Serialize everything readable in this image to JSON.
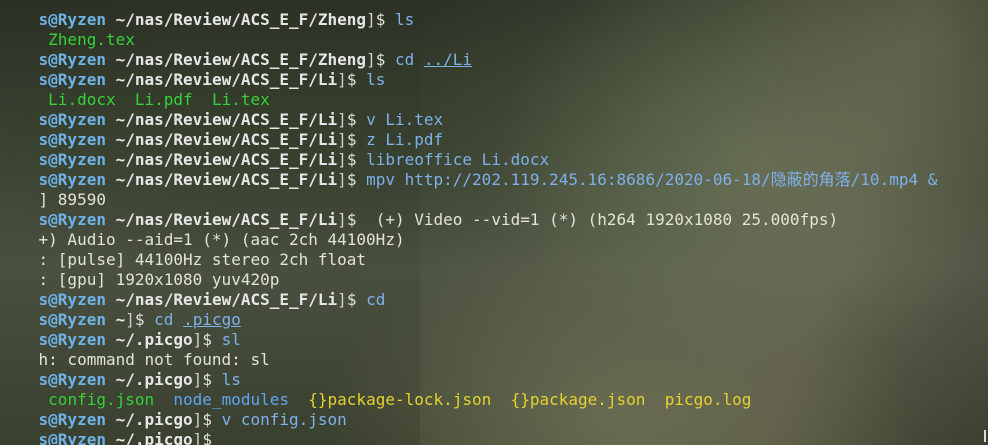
{
  "terminal": {
    "lines": [
      {
        "prompt_user": "s@Ryzen",
        "prompt_path": "~/nas/Review/ACS_E_F/Zheng",
        "prompt_end": "$",
        "command": " ls"
      },
      {
        "output": " Zheng.tex"
      },
      {
        "prompt_user": "s@Ryzen",
        "prompt_path": "~/nas/Review/ACS_E_F/Zheng",
        "prompt_end": "$",
        "command": " cd ",
        "command_arg": "../Li"
      },
      {
        "prompt_user": "s@Ryzen",
        "prompt_path": "~/nas/Review/ACS_E_F/Li",
        "prompt_end": "$",
        "command": " ls"
      },
      {
        "files": [
          {
            "icon": " ",
            "name": "Li.docx"
          },
          {
            "icon": "  ",
            "name": "Li.pdf"
          },
          {
            "icon": "  ",
            "name": "Li.tex"
          }
        ]
      },
      {
        "prompt_user": "s@Ryzen",
        "prompt_path": "~/nas/Review/ACS_E_F/Li",
        "prompt_end": "$",
        "command": " v Li.tex"
      },
      {
        "prompt_user": "s@Ryzen",
        "prompt_path": "~/nas/Review/ACS_E_F/Li",
        "prompt_end": "$",
        "command": " z Li.pdf"
      },
      {
        "prompt_user": "s@Ryzen",
        "prompt_path": "~/nas/Review/ACS_E_F/Li",
        "prompt_end": "$",
        "command": " libreoffice Li.docx"
      },
      {
        "prompt_user": "s@Ryzen",
        "prompt_path": "~/nas/Review/ACS_E_F/Li",
        "prompt_end": "$",
        "command": " mpv http://202.119.245.16:8686/2020-06-18/隐蔽的角落/10.mp4 &"
      },
      {
        "output": "] 89590"
      },
      {
        "prompt_user": "s@Ryzen",
        "prompt_path": "~/nas/Review/ACS_E_F/Li",
        "prompt_end": "$",
        "command": "  (+) Video --vid=1 (*) (h264 1920x1080 25.000fps)"
      },
      {
        "output": "+) Audio --aid=1 (*) (aac 2ch 44100Hz)"
      },
      {
        "output": ": [pulse] 44100Hz stereo 2ch float"
      },
      {
        "output": ": [gpu] 1920x1080 yuv420p"
      },
      {
        "prompt_user": "s@Ryzen",
        "prompt_path": "~/nas/Review/ACS_E_F/Li",
        "prompt_end": "$",
        "command": " cd"
      },
      {
        "prompt_user": "s@Ryzen",
        "prompt_path": "~",
        "prompt_end": "$",
        "command": " cd ",
        "command_arg": ".picgo"
      },
      {
        "prompt_user": "s@Ryzen",
        "prompt_path": "~/.picgo",
        "prompt_end": "$",
        "command": " sl"
      },
      {
        "output": "h: command not found: sl"
      },
      {
        "prompt_user": "s@Ryzen",
        "prompt_path": "~/.picgo",
        "prompt_end": "$",
        "command": " ls"
      },
      {
        "files": [
          {
            "icon": " ",
            "name": "config.json"
          },
          {
            "icon": "  ",
            "name": "node_modules"
          },
          {
            "icon": "  {}",
            "name": "package-lock.json"
          },
          {
            "icon": "  {}",
            "name": "package.json"
          },
          {
            "icon": "  ",
            "name": "picgo.log"
          }
        ]
      },
      {
        "prompt_user": "s@Ryzen",
        "prompt_path": "~/.picgo",
        "prompt_end": "$",
        "command": " v config.json"
      },
      {
        "prompt_user": "s@Ryzen",
        "prompt_path": "~/.picgo",
        "prompt_end": "$",
        "command": ""
      }
    ]
  }
}
